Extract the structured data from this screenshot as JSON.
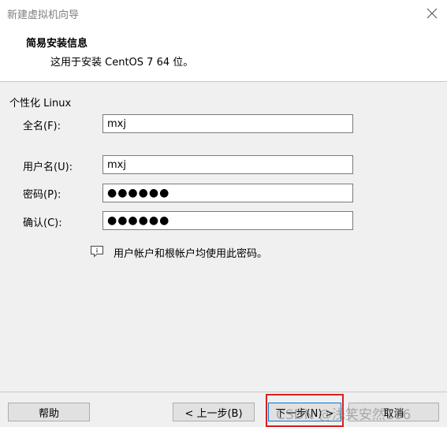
{
  "window": {
    "title": "新建虚拟机向导"
  },
  "header": {
    "title": "简易安装信息",
    "subtitle": "这用于安装 CentOS 7 64 位。"
  },
  "form": {
    "group_title": "个性化 Linux",
    "fullname": {
      "label": "全名(F):",
      "value": "mxj"
    },
    "username": {
      "label": "用户名(U):",
      "value": "mxj"
    },
    "password": {
      "label": "密码(P):",
      "value": "●●●●●●"
    },
    "confirm": {
      "label": "确认(C):",
      "value": "●●●●●●"
    },
    "note": "用户帐户和根帐户均使用此密码。"
  },
  "footer": {
    "help": "帮助",
    "back": "< 上一步(B)",
    "next": "下一步(N) >",
    "cancel": "取消"
  },
  "watermark": "CSDN @浅笑安然106",
  "colors": {
    "highlight": "#d82020",
    "accent": "#0078d7"
  }
}
